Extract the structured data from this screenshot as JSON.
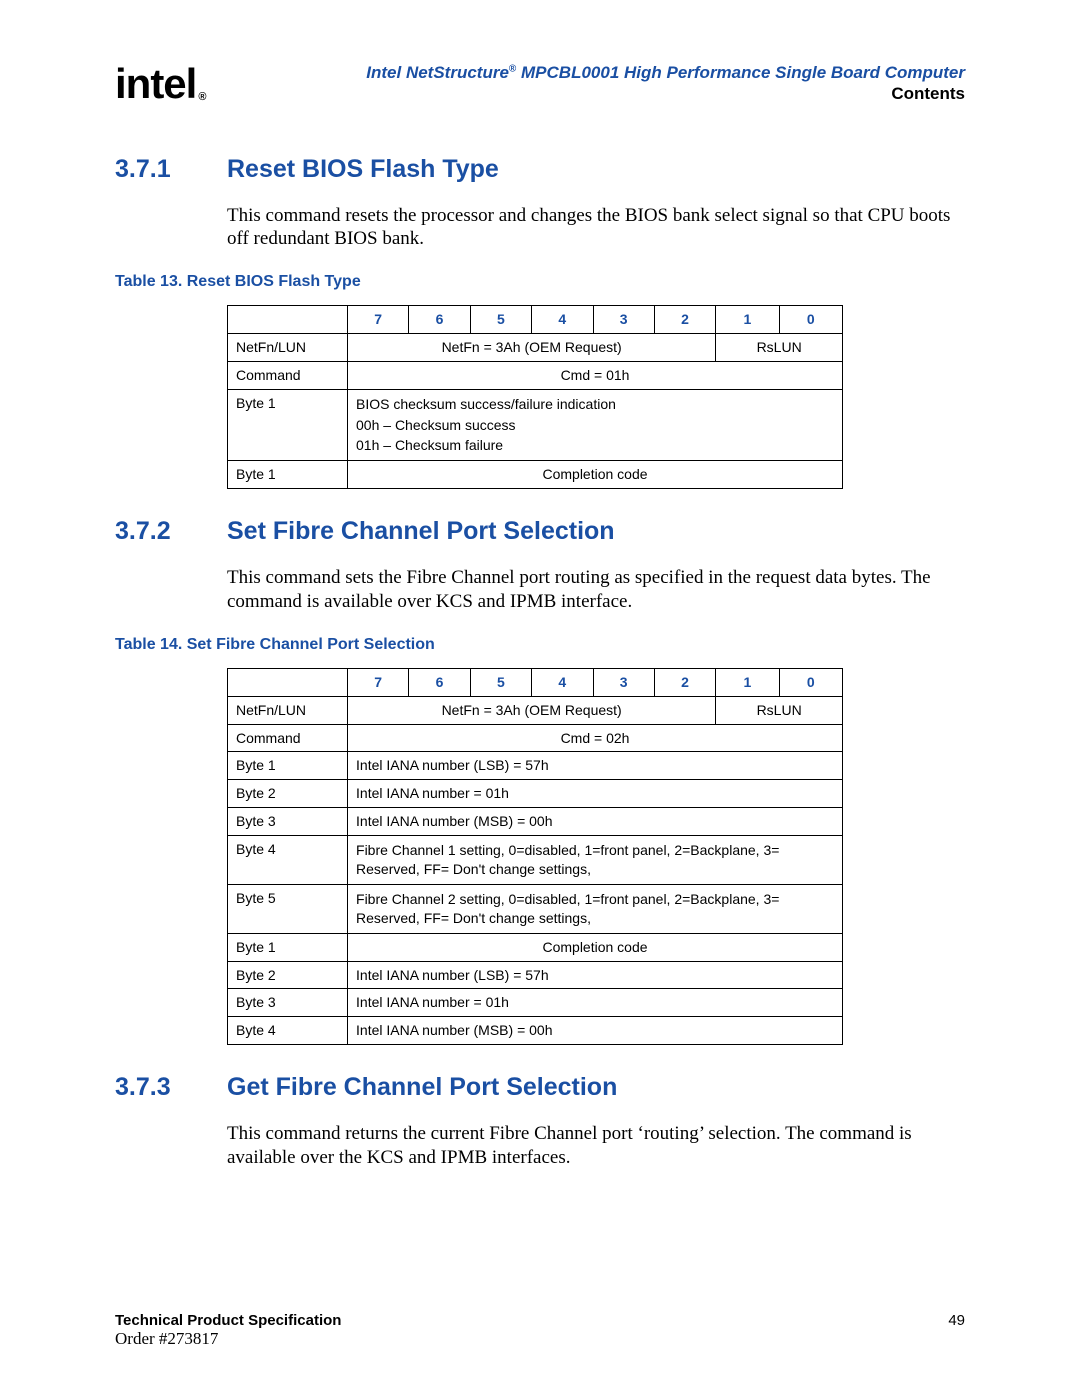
{
  "header": {
    "logo_text": "intel",
    "title_prefix": "Intel NetStructure",
    "title_suffix": " MPCBL0001 High Performance Single Board Computer",
    "subtitle": "Contents"
  },
  "sections": [
    {
      "num": "3.7.1",
      "title": "Reset BIOS Flash Type",
      "body": "This command resets the processor and changes the BIOS bank select signal so that CPU boots off redundant BIOS bank.",
      "table_caption": "Table 13.   Reset BIOS Flash Type",
      "bits": [
        "7",
        "6",
        "5",
        "4",
        "3",
        "2",
        "1",
        "0"
      ],
      "rows": [
        {
          "label": "NetFn/LUN",
          "cells": [
            {
              "text": "NetFn = 3Ah (OEM Request)",
              "span": 6,
              "align": "center"
            },
            {
              "text": "RsLUN",
              "span": 2,
              "align": "center"
            }
          ]
        },
        {
          "label": "Command",
          "cells": [
            {
              "text": "Cmd = 01h",
              "span": 8,
              "align": "center"
            }
          ]
        },
        {
          "label": "Byte 1",
          "cells": [
            {
              "lines": [
                "BIOS checksum success/failure indication",
                "00h – Checksum success",
                "01h – Checksum failure"
              ],
              "span": 8,
              "align": "left"
            }
          ]
        },
        {
          "label": "Byte 1",
          "cells": [
            {
              "text": "Completion code",
              "span": 8,
              "align": "center"
            }
          ]
        }
      ]
    },
    {
      "num": "3.7.2",
      "title": "Set Fibre Channel Port Selection",
      "body": "This command sets the Fibre Channel port routing as specified in the request data bytes. The command is available over KCS and IPMB interface.",
      "table_caption": "Table 14.   Set Fibre Channel Port Selection",
      "bits": [
        "7",
        "6",
        "5",
        "4",
        "3",
        "2",
        "1",
        "0"
      ],
      "rows": [
        {
          "label": "NetFn/LUN",
          "cells": [
            {
              "text": "NetFn = 3Ah (OEM Request)",
              "span": 6,
              "align": "center"
            },
            {
              "text": "RsLUN",
              "span": 2,
              "align": "center"
            }
          ]
        },
        {
          "label": "Command",
          "cells": [
            {
              "text": "Cmd = 02h",
              "span": 8,
              "align": "center"
            }
          ]
        },
        {
          "label": "Byte 1",
          "cells": [
            {
              "text": "Intel IANA number (LSB) = 57h",
              "span": 8,
              "align": "left"
            }
          ]
        },
        {
          "label": "Byte 2",
          "cells": [
            {
              "text": "Intel IANA number = 01h",
              "span": 8,
              "align": "left"
            }
          ]
        },
        {
          "label": "Byte 3",
          "cells": [
            {
              "text": "Intel IANA number (MSB) = 00h",
              "span": 8,
              "align": "left"
            }
          ]
        },
        {
          "label": "Byte 4",
          "cells": [
            {
              "lines": [
                "Fibre Channel 1 setting, 0=disabled, 1=front panel, 2=Backplane, 3= Reserved, FF= Don't change settings,"
              ],
              "span": 8,
              "align": "left"
            }
          ]
        },
        {
          "label": "Byte 5",
          "cells": [
            {
              "lines": [
                "Fibre Channel 2 setting, 0=disabled, 1=front panel, 2=Backplane, 3= Reserved, FF= Don't change settings,"
              ],
              "span": 8,
              "align": "left"
            }
          ]
        },
        {
          "label": "Byte 1",
          "cells": [
            {
              "text": "Completion code",
              "span": 8,
              "align": "center"
            }
          ]
        },
        {
          "label": "Byte 2",
          "cells": [
            {
              "text": "Intel IANA number (LSB) = 57h",
              "span": 8,
              "align": "left"
            }
          ]
        },
        {
          "label": "Byte 3",
          "cells": [
            {
              "text": "Intel IANA number = 01h",
              "span": 8,
              "align": "left"
            }
          ]
        },
        {
          "label": "Byte 4",
          "cells": [
            {
              "text": "Intel IANA number (MSB) = 00h",
              "span": 8,
              "align": "left"
            }
          ]
        }
      ]
    },
    {
      "num": "3.7.3",
      "title": "Get Fibre Channel Port Selection",
      "body": "This command returns the current Fibre Channel port ‘routing’ selection. The command is available over the KCS and IPMB interfaces."
    }
  ],
  "footer": {
    "spec": "Technical Product Specification",
    "order": "Order #273817",
    "page": "49"
  }
}
